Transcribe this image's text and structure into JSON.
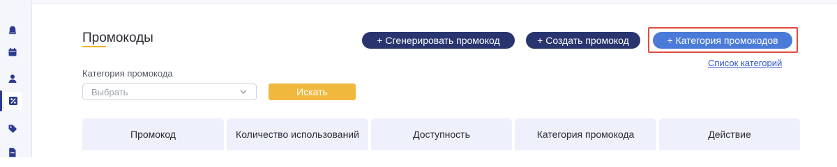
{
  "sidebar": {
    "items": [
      {
        "icon": "bell-icon"
      },
      {
        "icon": "calendar-icon"
      },
      {
        "icon": "user-icon"
      },
      {
        "icon": "percent-icon",
        "active": true
      },
      {
        "icon": "tag-icon"
      },
      {
        "icon": "document-icon"
      }
    ],
    "accent_color": "#2c3a8f"
  },
  "header": {
    "title": "Промокоды"
  },
  "actions": {
    "generate_label": "+ Сгенерировать промокод",
    "create_label": "+ Создать промокод",
    "category_label": "+ Категория промокодов",
    "category_list_link": "Список категорий"
  },
  "filter": {
    "category_label": "Категория промокода",
    "select_placeholder": "Выбрать",
    "search_label": "Искать"
  },
  "table": {
    "columns": [
      "Промокод",
      "Количество использований",
      "Доступность",
      "Категория промокода",
      "Действие"
    ]
  },
  "colors": {
    "primary_button": "#28356e",
    "secondary_button": "#4b7bd8",
    "search_button": "#f0b83c",
    "highlight": "#e04b3c",
    "link": "#2f54c7"
  }
}
